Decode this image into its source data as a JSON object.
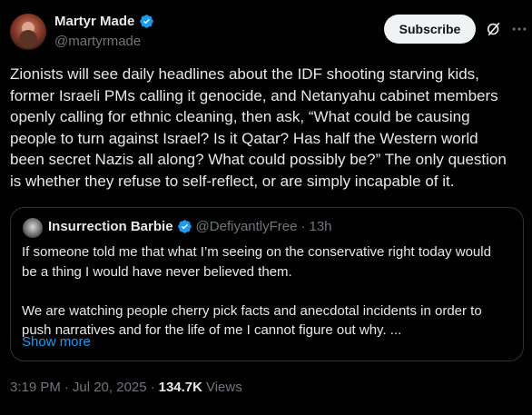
{
  "author": {
    "display_name": "Martyr Made",
    "handle": "@martyrmade"
  },
  "actions": {
    "subscribe_label": "Subscribe"
  },
  "post": {
    "text": "Zionists will see daily headlines about the IDF shooting starving kids,\nformer Israeli PMs calling it genocide, and Netanyahu cabinet members\nopenly calling for ethnic cleaning, then ask, “What could be causing\npeople to turn against Israel? Is it Qatar? Has half the Western world\nbeen secret Nazis all along? What could possibly be?” The only question\nis whether they refuse to self-reflect, or are simply incapable of it."
  },
  "quote": {
    "display_name": "Insurrection Barbie",
    "handle": "@DefiyantlyFree",
    "separator": "·",
    "time": "13h",
    "text": "If someone told me that what I’m seeing on the conservative right today would\nbe a thing I would have never believed them.\n\nWe are watching people cherry pick facts and anecdotal incidents in order to\npush narratives and for the life of me I cannot figure out why. ...",
    "show_more": "Show more"
  },
  "meta": {
    "time": "3:19 PM",
    "separator": "·",
    "date": "Jul 20, 2025",
    "separator2": "·",
    "views_count": "134.7K",
    "views_label": "Views"
  },
  "colors": {
    "background": "#000000",
    "text": "#e7e9ea",
    "secondary": "#71767b",
    "accent": "#1d9bf0",
    "verified": "#1d9bf0",
    "border": "#2f3336"
  },
  "icons": {
    "verified": "verified-badge-icon",
    "grok": "grok-icon",
    "more": "more-icon"
  }
}
